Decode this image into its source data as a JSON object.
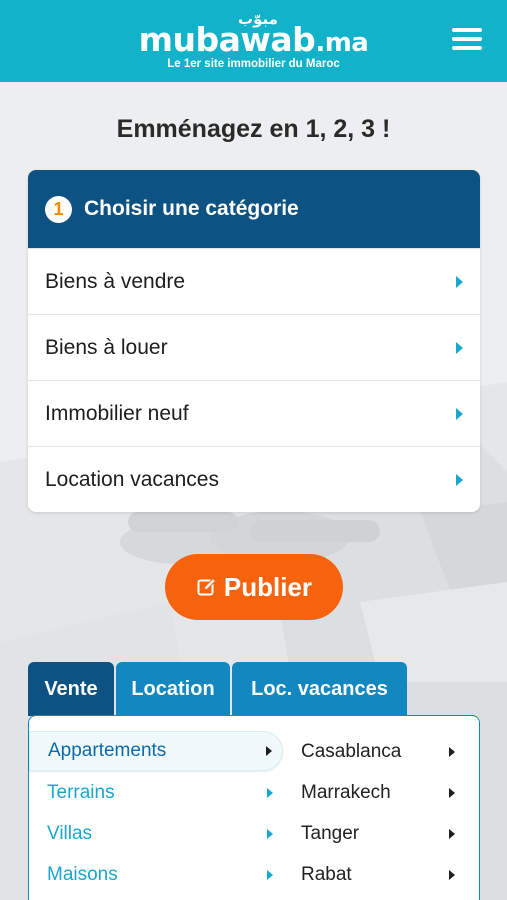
{
  "header": {
    "logo_arabic": "مبوّب",
    "logo_main": "mubawab",
    "logo_tld": ".ma",
    "tagline": "Le 1er site immobilier du Maroc",
    "menu_icon": "hamburger-menu-icon"
  },
  "headline": "Emménagez en 1, 2, 3 !",
  "category_card": {
    "step": "1",
    "title": "Choisir une catégorie",
    "items": [
      {
        "label": "Biens à vendre"
      },
      {
        "label": "Biens à louer"
      },
      {
        "label": "Immobilier neuf"
      },
      {
        "label": "Location vacances"
      }
    ]
  },
  "publish": {
    "label": "Publier",
    "icon": "edit-icon"
  },
  "tabs": [
    {
      "label": "Vente",
      "active": true
    },
    {
      "label": "Location",
      "active": false
    },
    {
      "label": "Loc. vacances",
      "active": false
    }
  ],
  "property_types": [
    {
      "label": "Appartements",
      "selected": true
    },
    {
      "label": "Terrains",
      "selected": false
    },
    {
      "label": "Villas",
      "selected": false
    },
    {
      "label": "Maisons",
      "selected": false
    }
  ],
  "cities": [
    {
      "label": "Casablanca"
    },
    {
      "label": "Marrakech"
    },
    {
      "label": "Tanger"
    },
    {
      "label": "Rabat"
    }
  ],
  "colors": {
    "header": "#12b2cb",
    "navy": "#0c5384",
    "tab_blue": "#1287c0",
    "accent_orange": "#f7630c",
    "link_cyan": "#1aa7cf"
  }
}
